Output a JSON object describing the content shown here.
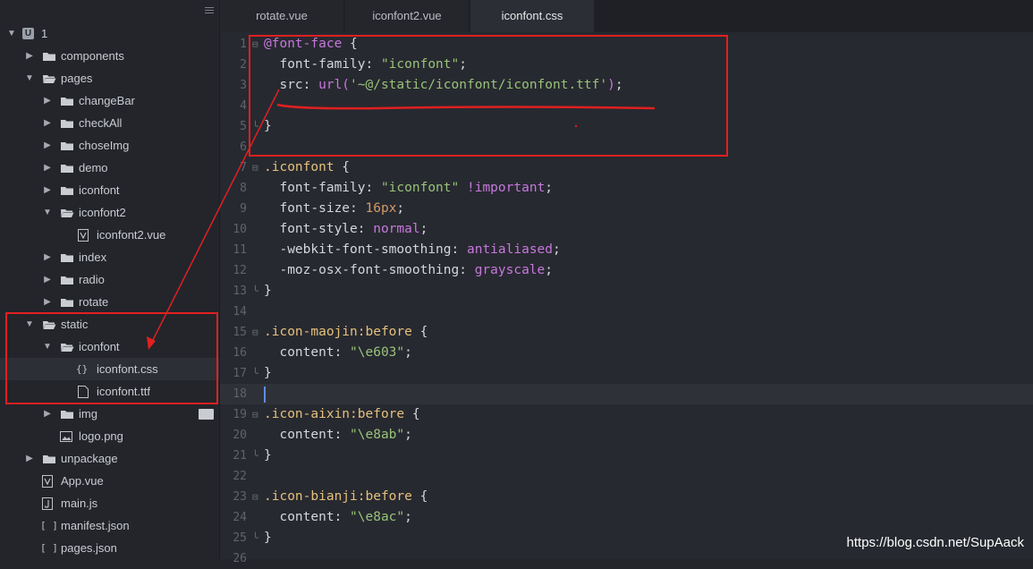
{
  "sidebar": {
    "root": {
      "label": "1",
      "badge": "U"
    },
    "items": [
      {
        "label": "components",
        "kind": "folder"
      },
      {
        "label": "pages",
        "kind": "folder"
      },
      {
        "label": "changeBar",
        "kind": "folder"
      },
      {
        "label": "checkAll",
        "kind": "folder"
      },
      {
        "label": "choseImg",
        "kind": "folder"
      },
      {
        "label": "demo",
        "kind": "folder"
      },
      {
        "label": "iconfont",
        "kind": "folder"
      },
      {
        "label": "iconfont2",
        "kind": "folder"
      },
      {
        "label": "iconfont2.vue",
        "kind": "vue"
      },
      {
        "label": "index",
        "kind": "folder"
      },
      {
        "label": "radio",
        "kind": "folder"
      },
      {
        "label": "rotate",
        "kind": "folder"
      },
      {
        "label": "static",
        "kind": "folder"
      },
      {
        "label": "iconfont",
        "kind": "folder"
      },
      {
        "label": "iconfont.css",
        "kind": "css",
        "glyph": "{}"
      },
      {
        "label": "iconfont.ttf",
        "kind": "file"
      },
      {
        "label": "img",
        "kind": "folder"
      },
      {
        "label": "logo.png",
        "kind": "image"
      },
      {
        "label": "unpackage",
        "kind": "folder"
      },
      {
        "label": "App.vue",
        "kind": "vue"
      },
      {
        "label": "main.js",
        "kind": "js"
      },
      {
        "label": "manifest.json",
        "kind": "json",
        "glyph": "[ ]"
      },
      {
        "label": "pages.json",
        "kind": "json",
        "glyph": "[ ]"
      }
    ]
  },
  "tabs": [
    {
      "label": "rotate.vue"
    },
    {
      "label": "iconfont2.vue"
    },
    {
      "label": "iconfont.css",
      "active": true
    }
  ],
  "code": {
    "current_line": 18,
    "lines": [
      {
        "n": "1",
        "fold": "⊟",
        "parts": [
          [
            "at",
            "@font-face"
          ],
          [
            "punct",
            " {"
          ]
        ]
      },
      {
        "n": "2",
        "parts": [
          [
            "prop",
            "  font-family: "
          ],
          [
            "str",
            "\"iconfont\""
          ],
          [
            "punct",
            ";"
          ]
        ]
      },
      {
        "n": "3",
        "parts": [
          [
            "prop",
            "  src: "
          ],
          [
            "fn",
            "url("
          ],
          [
            "str",
            "'~@/static/iconfont/iconfont.ttf'"
          ],
          [
            "fn",
            ")"
          ],
          [
            "punct",
            ";"
          ]
        ]
      },
      {
        "n": "4",
        "parts": []
      },
      {
        "n": "5",
        "fold": "╰",
        "parts": [
          [
            "punct",
            "}"
          ]
        ]
      },
      {
        "n": "6",
        "parts": []
      },
      {
        "n": "7",
        "fold": "⊟",
        "parts": [
          [
            "sel",
            ".iconfont"
          ],
          [
            "punct",
            " {"
          ]
        ]
      },
      {
        "n": "8",
        "parts": [
          [
            "prop",
            "  font-family: "
          ],
          [
            "str",
            "\"iconfont\""
          ],
          [
            "kw",
            " !important"
          ],
          [
            "punct",
            ";"
          ]
        ]
      },
      {
        "n": "9",
        "parts": [
          [
            "prop",
            "  font-size: "
          ],
          [
            "num",
            "16px"
          ],
          [
            "punct",
            ";"
          ]
        ]
      },
      {
        "n": "10",
        "parts": [
          [
            "prop",
            "  font-style: "
          ],
          [
            "kw",
            "normal"
          ],
          [
            "punct",
            ";"
          ]
        ]
      },
      {
        "n": "11",
        "parts": [
          [
            "prop",
            "  -webkit-font-smoothing: "
          ],
          [
            "kw",
            "antialiased"
          ],
          [
            "punct",
            ";"
          ]
        ]
      },
      {
        "n": "12",
        "parts": [
          [
            "prop",
            "  -moz-osx-font-smoothing: "
          ],
          [
            "kw",
            "grayscale"
          ],
          [
            "punct",
            ";"
          ]
        ]
      },
      {
        "n": "13",
        "fold": "╰",
        "parts": [
          [
            "punct",
            "}"
          ]
        ]
      },
      {
        "n": "14",
        "parts": []
      },
      {
        "n": "15",
        "fold": "⊟",
        "parts": [
          [
            "sel",
            ".icon-maojin:before"
          ],
          [
            "punct",
            " {"
          ]
        ]
      },
      {
        "n": "16",
        "parts": [
          [
            "prop",
            "  content: "
          ],
          [
            "str",
            "\"\\e603\""
          ],
          [
            "punct",
            ";"
          ]
        ]
      },
      {
        "n": "17",
        "fold": "╰",
        "parts": [
          [
            "punct",
            "}"
          ]
        ]
      },
      {
        "n": "18",
        "parts": []
      },
      {
        "n": "19",
        "fold": "⊟",
        "parts": [
          [
            "sel",
            ".icon-aixin:before"
          ],
          [
            "punct",
            " {"
          ]
        ]
      },
      {
        "n": "20",
        "parts": [
          [
            "prop",
            "  content: "
          ],
          [
            "str",
            "\"\\e8ab\""
          ],
          [
            "punct",
            ";"
          ]
        ]
      },
      {
        "n": "21",
        "fold": "╰",
        "parts": [
          [
            "punct",
            "}"
          ]
        ]
      },
      {
        "n": "22",
        "parts": []
      },
      {
        "n": "23",
        "fold": "⊟",
        "parts": [
          [
            "sel",
            ".icon-bianji:before"
          ],
          [
            "punct",
            " {"
          ]
        ]
      },
      {
        "n": "24",
        "parts": [
          [
            "prop",
            "  content: "
          ],
          [
            "str",
            "\"\\e8ac\""
          ],
          [
            "punct",
            ";"
          ]
        ]
      },
      {
        "n": "25",
        "fold": "╰",
        "parts": [
          [
            "punct",
            "}"
          ]
        ]
      },
      {
        "n": "26",
        "parts": []
      }
    ]
  },
  "watermark": "https://blog.csdn.net/SupAack",
  "colors": {
    "annotation": "#e02020",
    "accent": "#5d8cf5"
  }
}
